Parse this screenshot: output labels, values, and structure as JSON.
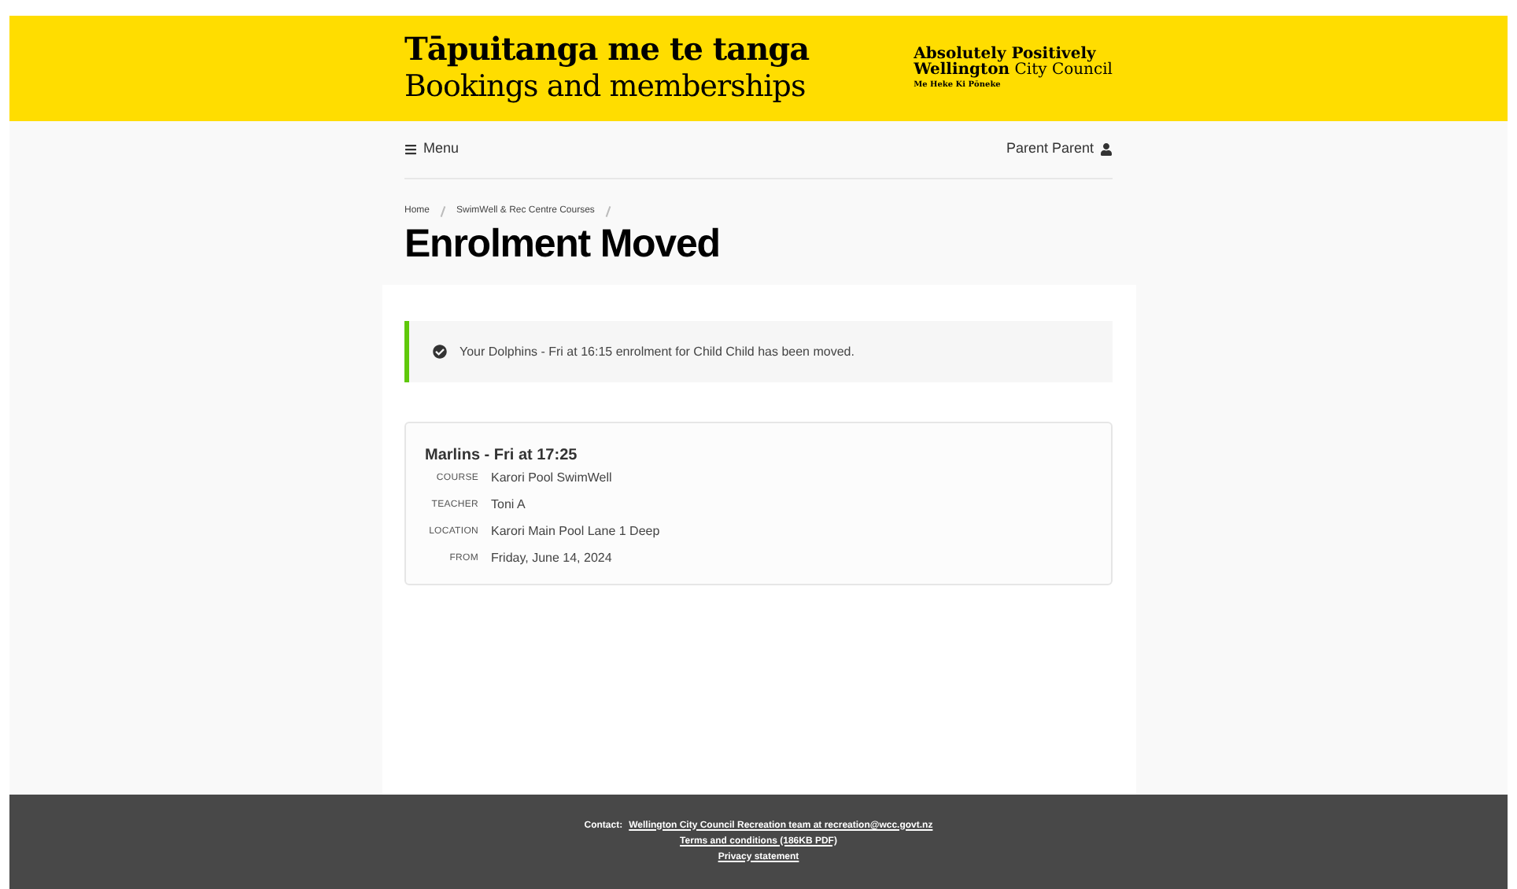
{
  "header": {
    "title": "Tāpuitanga me te tanga",
    "subtitle": "Bookings and memberships",
    "council": {
      "line_1": "Absolutely Positively",
      "line_2_bold": "Wellington",
      "line_2_rest": "City Council",
      "tagline": "Me Heke Ki Pōneke"
    }
  },
  "nav": {
    "menu": "Menu",
    "user": "Parent Parent"
  },
  "breadcrumbs": [
    "Home",
    "SwimWell & Rec Centre Courses"
  ],
  "page_title": "Enrolment Moved",
  "alert": {
    "message": "Your Dolphins - Fri at 16:15 enrolment for Child Child has been moved."
  },
  "enrolment": {
    "title": "Marlins - Fri at 17:25",
    "fields": [
      {
        "label": "COURSE",
        "value": "Karori Pool SwimWell"
      },
      {
        "label": "TEACHER",
        "value": "Toni A"
      },
      {
        "label": "LOCATION",
        "value": "Karori Main Pool Lane 1 Deep"
      },
      {
        "label": "FROM",
        "value": "Friday, June 14, 2024"
      }
    ]
  },
  "footer": {
    "contact_label": "Contact:",
    "contact_link": "Wellington City Council Recreation team at recreation@wcc.govt.nz",
    "terms": "Terms and conditions (186KB PDF)",
    "privacy": "Privacy statement"
  }
}
